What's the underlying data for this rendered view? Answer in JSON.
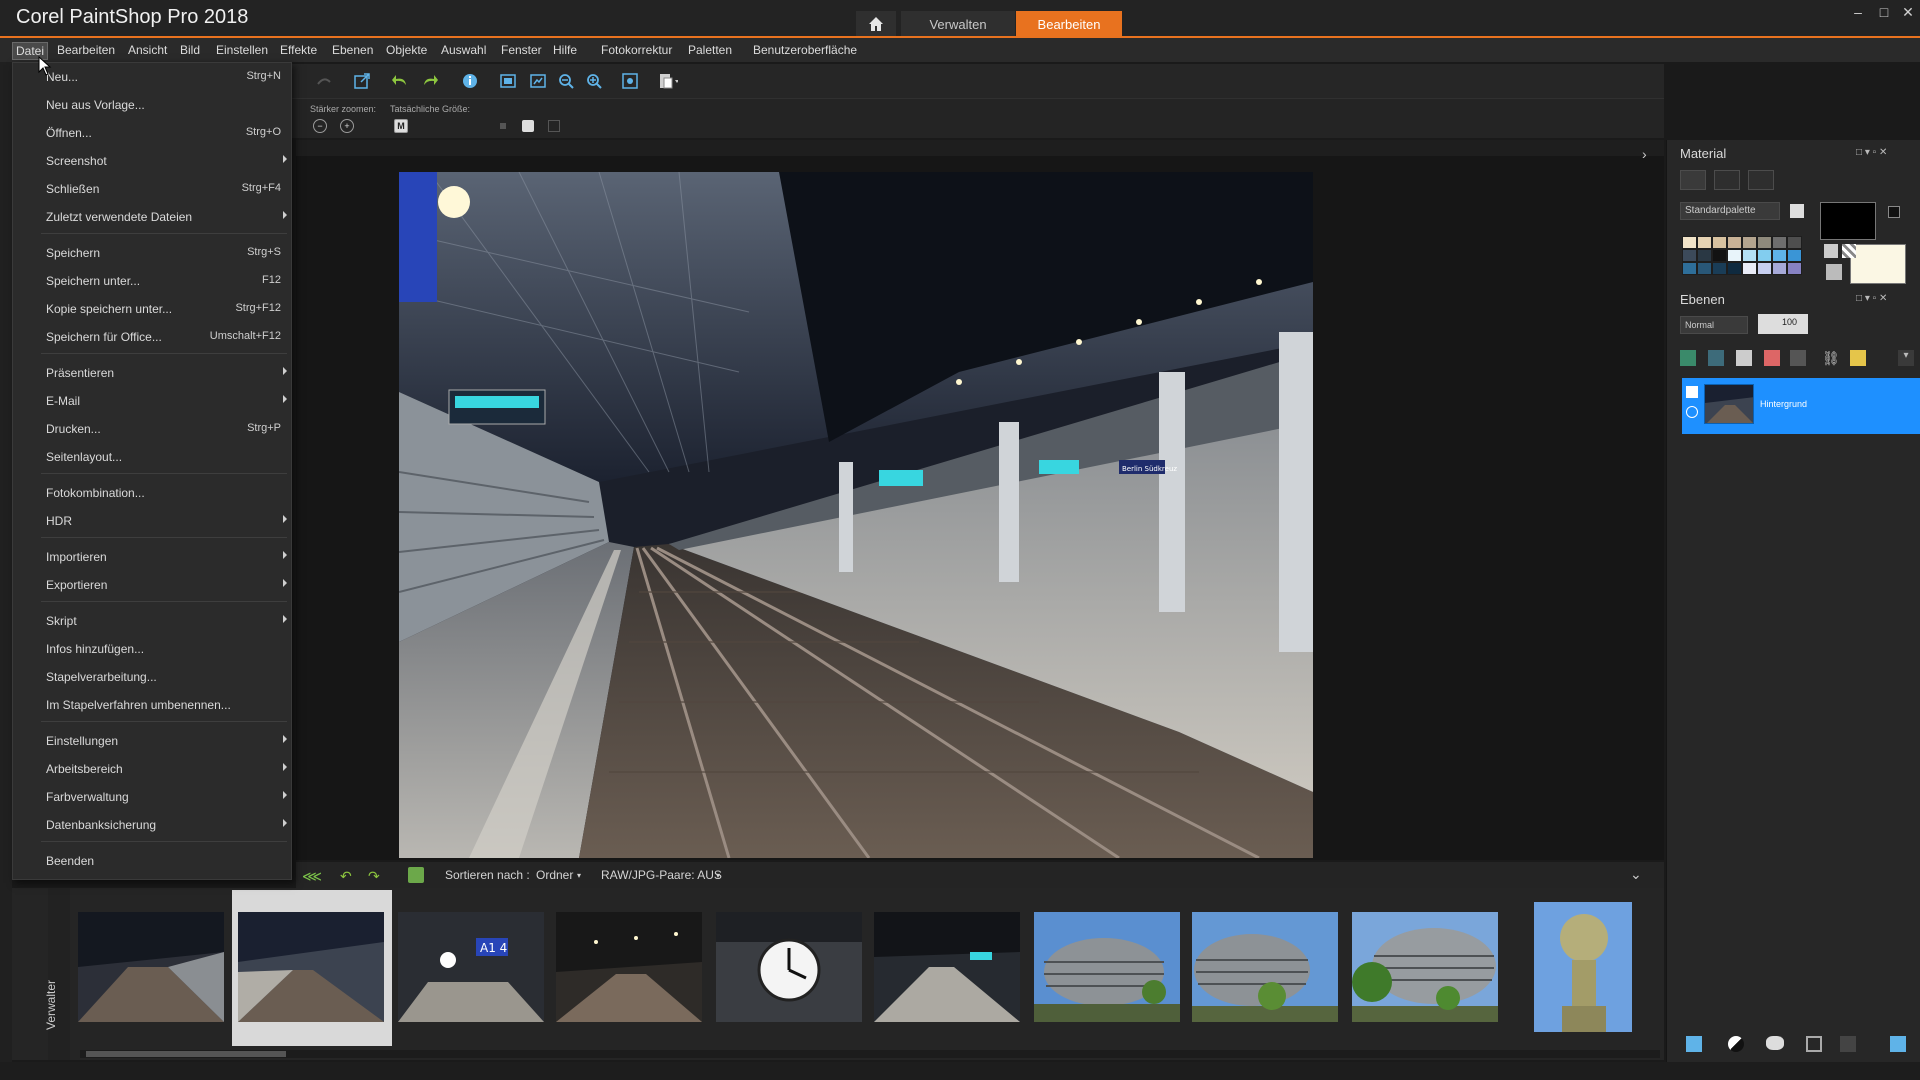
{
  "app": {
    "title": "Corel PaintShop Pro 2018",
    "tabs": {
      "manage": "Verwalten",
      "edit": "Bearbeiten"
    },
    "accent_color": "#e8721f"
  },
  "window_controls": {
    "minimize": "–",
    "maximize": "□",
    "close": "✕"
  },
  "menubar": [
    "Datei",
    "Bearbeiten",
    "Ansicht",
    "Bild",
    "Einstellen",
    "Effekte",
    "Ebenen",
    "Objekte",
    "Auswahl",
    "Fenster",
    "Hilfe",
    "Fotokorrektur",
    "Paletten",
    "Benutzeroberfläche"
  ],
  "optionsbar": {
    "zoom_more": "Stärker zoomen:",
    "actual_size": "Tatsächliche Größe:",
    "actual_size_btn": "M"
  },
  "file_menu": {
    "items": [
      {
        "label": "Neu...",
        "shortcut": "Strg+N"
      },
      {
        "label": "Neu aus Vorlage...",
        "shortcut": ""
      },
      {
        "label": "Öffnen...",
        "shortcut": "Strg+O"
      },
      {
        "label": "Screenshot",
        "shortcut": "",
        "submenu": true
      },
      {
        "label": "Schließen",
        "shortcut": "Strg+F4"
      },
      {
        "label": "Zuletzt verwendete Dateien",
        "shortcut": "",
        "submenu": true
      },
      {
        "label": "Speichern",
        "shortcut": "Strg+S"
      },
      {
        "label": "Speichern unter...",
        "shortcut": "F12"
      },
      {
        "label": "Kopie speichern unter...",
        "shortcut": "Strg+F12"
      },
      {
        "label": "Speichern für Office...",
        "shortcut": "Umschalt+F12"
      },
      {
        "label": "Präsentieren",
        "shortcut": "",
        "submenu": true
      },
      {
        "label": "E-Mail",
        "shortcut": "",
        "submenu": true
      },
      {
        "label": "Drucken...",
        "shortcut": "Strg+P"
      },
      {
        "label": "Seitenlayout...",
        "shortcut": ""
      },
      {
        "label": "Fotokombination...",
        "shortcut": ""
      },
      {
        "label": "HDR",
        "shortcut": "",
        "submenu": true
      },
      {
        "label": "Importieren",
        "shortcut": "",
        "submenu": true
      },
      {
        "label": "Exportieren",
        "shortcut": "",
        "submenu": true
      },
      {
        "label": "Skript",
        "shortcut": "",
        "submenu": true
      },
      {
        "label": "Infos hinzufügen...",
        "shortcut": ""
      },
      {
        "label": "Stapelverarbeitung...",
        "shortcut": ""
      },
      {
        "label": "Im Stapelverfahren umbenennen...",
        "shortcut": ""
      },
      {
        "label": "Einstellungen",
        "shortcut": "",
        "submenu": true
      },
      {
        "label": "Arbeitsbereich",
        "shortcut": "",
        "submenu": true
      },
      {
        "label": "Farbverwaltung",
        "shortcut": "",
        "submenu": true
      },
      {
        "label": "Datenbanksicherung",
        "shortcut": "",
        "submenu": true
      },
      {
        "label": "Beenden",
        "shortcut": ""
      }
    ]
  },
  "material_panel": {
    "title": "Material",
    "palette_select": "Standardpalette",
    "fg_color": "#000000",
    "bg_color": "#fbf7e4"
  },
  "layers_panel": {
    "title": "Ebenen",
    "blend_mode": "Normal",
    "opacity": "100",
    "layer_name": "Hintergrund"
  },
  "organizer": {
    "sort_label": "Sortieren nach :",
    "sort_value": "Ordner",
    "raw_pairs": "RAW/JPG-Paare: AUS",
    "side_label": "Verwalter",
    "thumbnails": [
      {
        "name": "station-platform-1",
        "selected": false
      },
      {
        "name": "station-platform-2",
        "selected": true
      },
      {
        "name": "station-clock-sign",
        "selected": false,
        "sign_text": "A1 4"
      },
      {
        "name": "station-platform-3",
        "selected": false
      },
      {
        "name": "station-clock",
        "selected": false
      },
      {
        "name": "station-platform-4",
        "selected": false
      },
      {
        "name": "round-building-1",
        "selected": false
      },
      {
        "name": "round-building-2",
        "selected": false
      },
      {
        "name": "round-building-3",
        "selected": false
      },
      {
        "name": "atlas-statue",
        "selected": false
      }
    ]
  },
  "photo": {
    "sign_text": "Berlin Südkreuz"
  }
}
